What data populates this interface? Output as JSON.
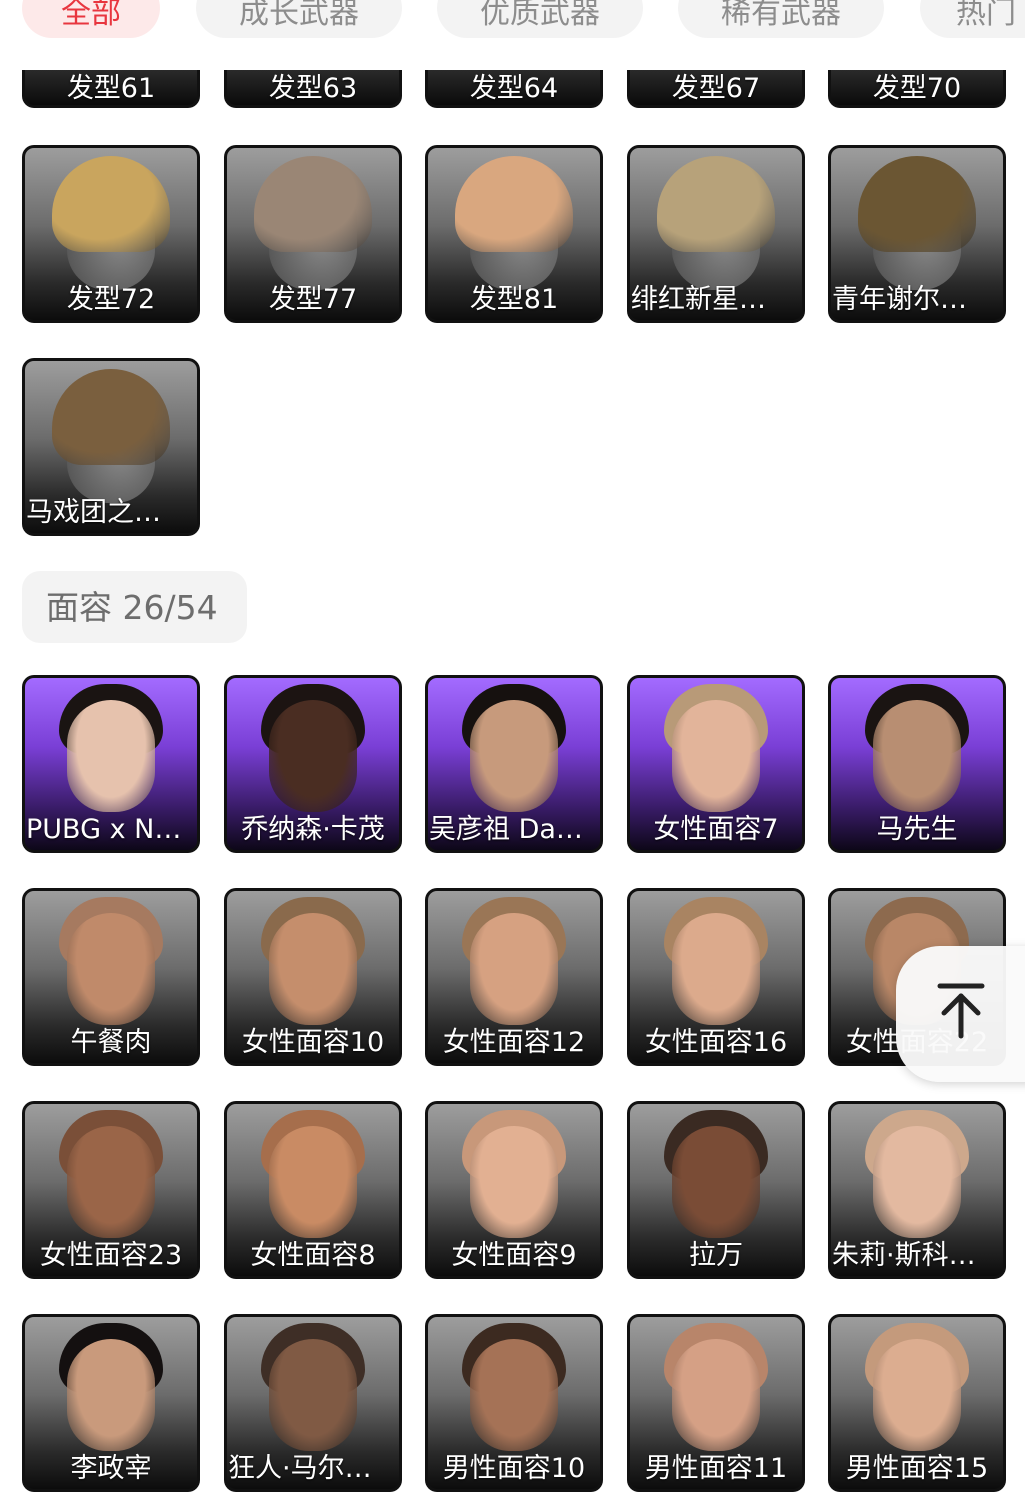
{
  "tabs": [
    {
      "label": "全部",
      "active": true
    },
    {
      "label": "成长武器",
      "active": false
    },
    {
      "label": "优质武器",
      "active": false
    },
    {
      "label": "稀有武器",
      "active": false
    },
    {
      "label": "热门",
      "active": false
    }
  ],
  "hair_section": {
    "items_partial": [
      "发型61",
      "发型63",
      "发型64",
      "发型67",
      "发型70"
    ],
    "items": [
      {
        "label": "发型72",
        "hair_color": "#c9a55e"
      },
      {
        "label": "发型77",
        "hair_color": "#9a8675"
      },
      {
        "label": "发型81",
        "hair_color": "#d9a77f"
      },
      {
        "label": "绯红新星…",
        "hair_color": "#b7a27a"
      },
      {
        "label": "青年谢尔…",
        "hair_color": "#6b5633"
      },
      {
        "label": "马戏团之…",
        "hair_color": "#7a5f3e"
      }
    ]
  },
  "face_section": {
    "title": "面容 26/54",
    "items": [
      {
        "label": "PUBG x N…",
        "rarity": "purple",
        "skin": "#e6c2ad",
        "hair": "#1a1412"
      },
      {
        "label": "乔纳森·卡茂",
        "rarity": "purple",
        "skin": "#4a2d22",
        "hair": "#1c1412"
      },
      {
        "label": "吴彦祖 Da…",
        "rarity": "purple",
        "skin": "#c79a7c",
        "hair": "#16110f"
      },
      {
        "label": "女性面容7",
        "rarity": "purple",
        "skin": "#e2b49a",
        "hair": "#b89a78"
      },
      {
        "label": "马先生",
        "rarity": "purple",
        "skin": "#b88e72",
        "hair": "#1a1412"
      },
      {
        "label": "午餐肉",
        "rarity": "gray",
        "skin": "#c08a6a",
        "hair": "#a67a60"
      },
      {
        "label": "女性面容10",
        "rarity": "gray",
        "skin": "#c58e6c",
        "hair": "#8a6a4c"
      },
      {
        "label": "女性面容12",
        "rarity": "gray",
        "skin": "#d6a181",
        "hair": "#9a7656"
      },
      {
        "label": "女性面容16",
        "rarity": "gray",
        "skin": "#dcaa8c",
        "hair": "#a98462"
      },
      {
        "label": "女性面容22",
        "rarity": "gray",
        "skin": "#b98767",
        "hair": "#8d6a4e"
      },
      {
        "label": "女性面容23",
        "rarity": "gray",
        "skin": "#9a6548",
        "hair": "#7a4f38"
      },
      {
        "label": "女性面容8",
        "rarity": "gray",
        "skin": "#c98b64",
        "hair": "#a66e4c"
      },
      {
        "label": "女性面容9",
        "rarity": "gray",
        "skin": "#e2b092",
        "hair": "#c8987a"
      },
      {
        "label": "拉万",
        "rarity": "gray",
        "skin": "#7a4c36",
        "hair": "#3a2a22"
      },
      {
        "label": "朱莉·斯科…",
        "rarity": "gray",
        "skin": "#e3b9a0",
        "hair": "#cda88c"
      },
      {
        "label": "李政宰",
        "rarity": "gray",
        "skin": "#c99a7c",
        "hair": "#141010"
      },
      {
        "label": "狂人·马尔…",
        "rarity": "gray",
        "skin": "#805a44",
        "hair": "#3e2e26"
      },
      {
        "label": "男性面容10",
        "rarity": "gray",
        "skin": "#a57256",
        "hair": "#3c2a20"
      },
      {
        "label": "男性面容11",
        "rarity": "gray",
        "skin": "#d5a085",
        "hair": "#b8856a"
      },
      {
        "label": "男性面容15",
        "rarity": "gray",
        "skin": "#dcad90",
        "hair": "#c49a7c"
      }
    ]
  },
  "back_to_top": {
    "icon": "arrow-up-to-top-icon"
  }
}
